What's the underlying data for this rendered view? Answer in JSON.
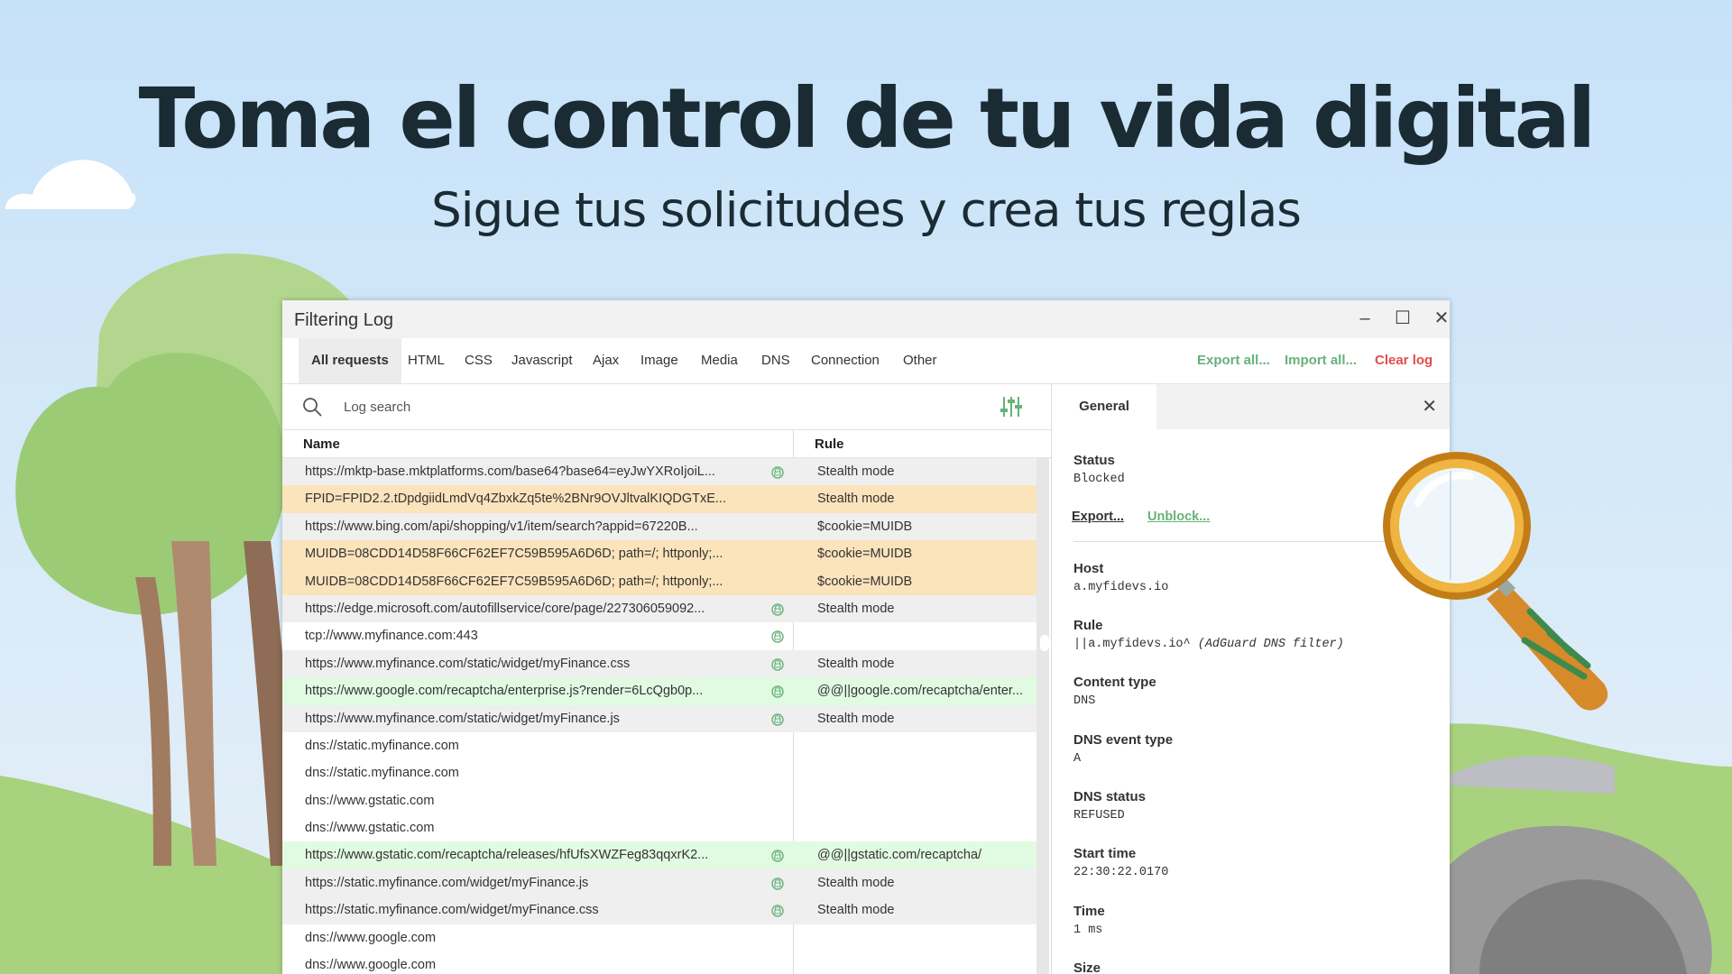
{
  "hero": {
    "title": "Toma el control de tu vida digital",
    "subtitle": "Sigue tus solicitudes y crea tus reglas"
  },
  "window": {
    "title": "Filtering Log",
    "controls": {
      "minimize": "–",
      "maximize": "☐",
      "close": "✕"
    }
  },
  "tabs": [
    "All requests",
    "HTML",
    "CSS",
    "Javascript",
    "Ajax",
    "Image",
    "Media",
    "DNS",
    "Connection",
    "Other"
  ],
  "actions": {
    "export_all": "Export all...",
    "import_all": "Import all...",
    "clear_log": "Clear log"
  },
  "search": {
    "placeholder": "Log search"
  },
  "columns": {
    "name": "Name",
    "rule": "Rule"
  },
  "rows": [
    {
      "url": "https://mktp-base.mktplatforms.com/base64?base64=eyJwYXRoIjoiL...",
      "rule": "Stealth mode",
      "lock": true,
      "style": "gray"
    },
    {
      "url": "FPID=FPID2.2.tDpdgiidLmdVq4ZbxkZq5te%2BNr9OVJltvalKIQDGTxE...",
      "rule": "Stealth mode",
      "lock": false,
      "style": "orange"
    },
    {
      "url": "https://www.bing.com/api/shopping/v1/item/search?appid=67220B...",
      "rule": "$cookie=MUIDB",
      "lock": false,
      "style": "gray"
    },
    {
      "url": "MUIDB=08CDD14D58F66CF62EF7C59B595A6D6D; path=/; httponly;...",
      "rule": "$cookie=MUIDB",
      "lock": false,
      "style": "orange"
    },
    {
      "url": "MUIDB=08CDD14D58F66CF62EF7C59B595A6D6D; path=/; httponly;...",
      "rule": "$cookie=MUIDB",
      "lock": false,
      "style": "orange"
    },
    {
      "url": "https://edge.microsoft.com/autofillservice/core/page/227306059092...",
      "rule": "Stealth mode",
      "lock": true,
      "style": "gray"
    },
    {
      "url": "tcp://www.myfinance.com:443",
      "rule": "",
      "lock": true,
      "style": "white"
    },
    {
      "url": "https://www.myfinance.com/static/widget/myFinance.css",
      "rule": "Stealth mode",
      "lock": true,
      "style": "gray"
    },
    {
      "url": "https://www.google.com/recaptcha/enterprise.js?render=6LcQgb0p...",
      "rule": "@@||google.com/recaptcha/enter...",
      "lock": true,
      "style": "green"
    },
    {
      "url": "https://www.myfinance.com/static/widget/myFinance.js",
      "rule": "Stealth mode",
      "lock": true,
      "style": "gray"
    },
    {
      "url": "dns://static.myfinance.com",
      "rule": "",
      "lock": false,
      "style": "white"
    },
    {
      "url": "dns://static.myfinance.com",
      "rule": "",
      "lock": false,
      "style": "white"
    },
    {
      "url": "dns://www.gstatic.com",
      "rule": "",
      "lock": false,
      "style": "white"
    },
    {
      "url": "dns://www.gstatic.com",
      "rule": "",
      "lock": false,
      "style": "white"
    },
    {
      "url": "https://www.gstatic.com/recaptcha/releases/hfUfsXWZFeg83qqxrK2...",
      "rule": "@@||gstatic.com/recaptcha/",
      "lock": true,
      "style": "green"
    },
    {
      "url": "https://static.myfinance.com/widget/myFinance.js",
      "rule": "Stealth mode",
      "lock": true,
      "style": "gray"
    },
    {
      "url": "https://static.myfinance.com/widget/myFinance.css",
      "rule": "Stealth mode",
      "lock": true,
      "style": "gray"
    },
    {
      "url": "dns://www.google.com",
      "rule": "",
      "lock": false,
      "style": "white"
    },
    {
      "url": "dns://www.google.com",
      "rule": "",
      "lock": false,
      "style": "white"
    }
  ],
  "details": {
    "tab": "General",
    "close": "✕",
    "status_label": "Status",
    "status": "Blocked",
    "export_link": "Export...",
    "unblock_link": "Unblock...",
    "host_label": "Host",
    "host": "a.myfidevs.io",
    "rule_label": "Rule",
    "rule": "||a.myfidevs.io^",
    "rule_source": "(AdGuard DNS filter)",
    "content_type_label": "Content type",
    "content_type": "DNS",
    "dns_event_type_label": "DNS event type",
    "dns_event_type": "A",
    "dns_status_label": "DNS status",
    "dns_status": "REFUSED",
    "start_time_label": "Start time",
    "start_time": "22:30:22.0170",
    "time_label": "Time",
    "time": "1 ms",
    "size_label": "Size"
  },
  "colors": {
    "accent_green": "#67b279",
    "danger_red": "#e34b4b",
    "row_orange": "#fbe3bb",
    "row_green": "#e1fbe2",
    "row_gray": "#efefef",
    "lock_icon": "#67b279"
  }
}
